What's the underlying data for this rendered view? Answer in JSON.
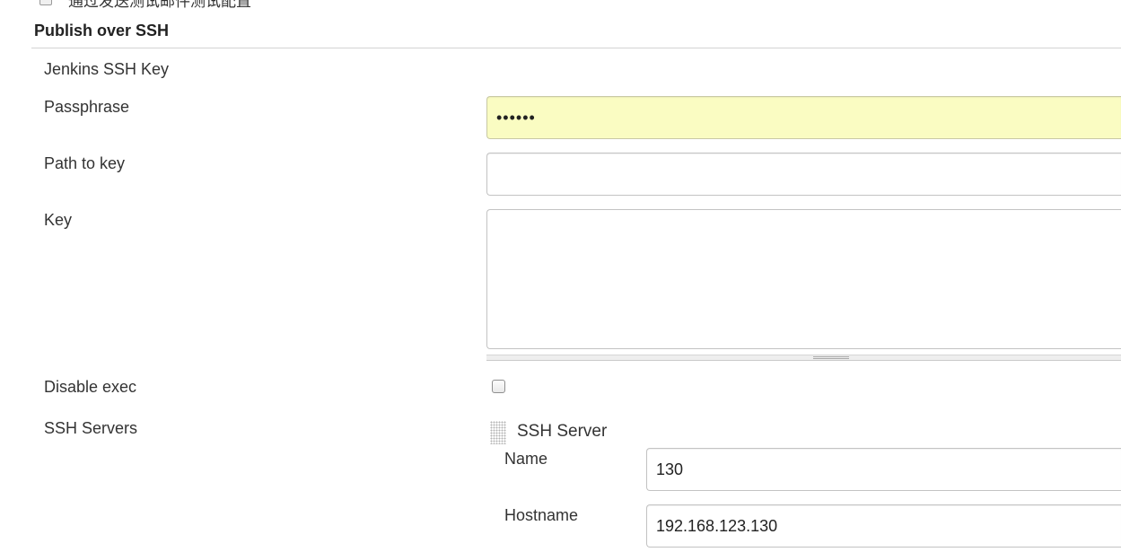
{
  "cutoff_row": {
    "label": "通过发送测试邮件测试配置"
  },
  "section": {
    "title": "Publish over SSH"
  },
  "fields": {
    "jenkins_ssh_key_label": "Jenkins SSH Key",
    "passphrase_label": "Passphrase",
    "passphrase_value": "••••••",
    "path_to_key_label": "Path to key",
    "path_to_key_value": "",
    "key_label": "Key",
    "key_value": "",
    "disable_exec_label": "Disable exec",
    "disable_exec_checked": false,
    "ssh_servers_label": "SSH Servers"
  },
  "ssh_server": {
    "title": "SSH Server",
    "name_label": "Name",
    "name_value": "130",
    "hostname_label": "Hostname",
    "hostname_value": "192.168.123.130"
  },
  "colors": {
    "passphrase_bg": "#fafcc2",
    "border": "#c3c3c3",
    "text": "#333333"
  },
  "icons": {
    "drag_handle": "drag-handle-icon"
  }
}
